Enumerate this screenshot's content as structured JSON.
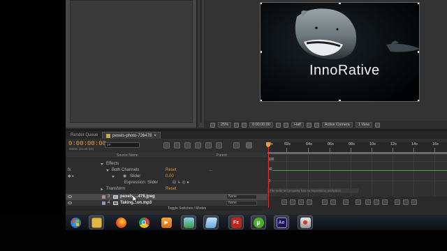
{
  "composition": {
    "text_overlay": "InnoRative"
  },
  "comp_toolbar": {
    "zoom": "25%",
    "time": "0:00:00:00",
    "resolution": "Half",
    "view": "Active Camera",
    "views": "1 View"
  },
  "tabs": {
    "render_queue": "Render Queue",
    "comp_name": "pexels-photo-726478"
  },
  "timeline": {
    "timecode": "0:00:00:00",
    "timecode_sub": "00000 (24.00 fps)",
    "search_placeholder": "ρ▾",
    "col_source": "Source Name",
    "col_parent": "Parent",
    "ruler": [
      "0s",
      "02s",
      "04s",
      "06s",
      "08s",
      "10s",
      "12s",
      "14s",
      "16s"
    ],
    "toggle_label": "Toggle Switches / Modes"
  },
  "layers": {
    "effects": "Effects",
    "both_channels": "Both Channels",
    "reset1": "Reset",
    "dots": "...",
    "slider": "Slider",
    "slider_value": "0.00",
    "expression": "Expression: Slider",
    "transform": "Transform",
    "reset2": "Reset",
    "layer3_num": "3",
    "layer3_name": "pexels-...478.jpeg",
    "layer4_num": "4",
    "layer4_name": "Taking...on.mp3",
    "parent_none": "None"
  },
  "graph": {
    "label_100": "100",
    "label_50": "50",
    "label_0": "0",
    "tip": "The selected property has no expression animation"
  },
  "taskbar": {
    "icons": [
      "windows-start-icon",
      "file-explorer-icon",
      "firefox-icon",
      "chrome-icon",
      "media-player-icon",
      "photo-app-icon",
      "notepad-icon",
      "filezilla-icon",
      "utorrent-icon",
      "after-effects-icon",
      "snipping-tool-icon"
    ],
    "ae_label": "Ae",
    "fz_label": "Fz",
    "ut_label": "µ"
  }
}
